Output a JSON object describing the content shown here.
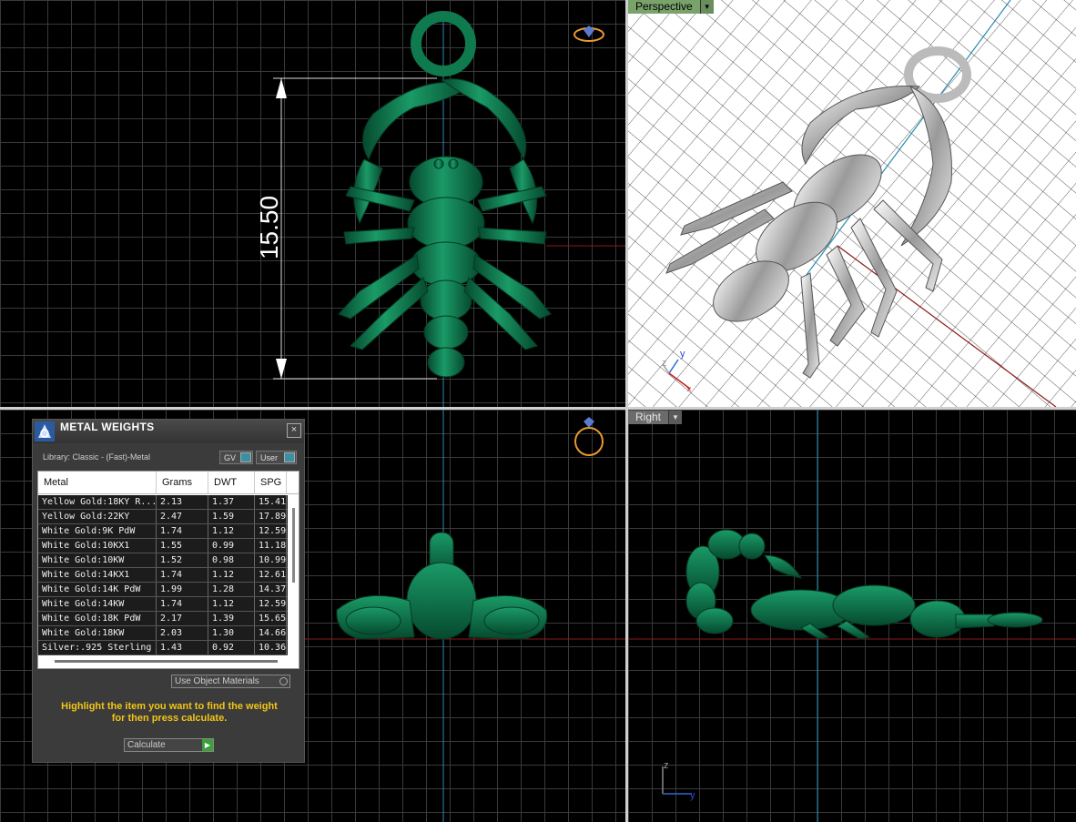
{
  "viewports": {
    "top": {
      "dimension_value": "15.50"
    },
    "perspective": {
      "label": "Perspective",
      "axis_y": "y",
      "axis_z": "z"
    },
    "right": {
      "label": "Right",
      "axis_z": "z",
      "axis_y": "y"
    }
  },
  "metal_weights": {
    "title": "METAL WEIGHTS",
    "close_glyph": "×",
    "library": "Library: Classic - (Fast)-Metal",
    "gv_label": "GV",
    "user_label": "User",
    "columns": [
      "Metal",
      "Grams",
      "DWT",
      "SPG"
    ],
    "rows": [
      [
        "Yellow Gold:18KY R...",
        "2.13",
        "1.37",
        "15.41"
      ],
      [
        "Yellow Gold:22KY",
        "2.47",
        "1.59",
        "17.89"
      ],
      [
        "White Gold:9K PdW",
        "1.74",
        "1.12",
        "12.59"
      ],
      [
        "White Gold:10KX1",
        "1.55",
        "0.99",
        "11.18"
      ],
      [
        "White Gold:10KW",
        "1.52",
        "0.98",
        "10.99"
      ],
      [
        "White Gold:14KX1",
        "1.74",
        "1.12",
        "12.61"
      ],
      [
        "White Gold:14K PdW",
        "1.99",
        "1.28",
        "14.37"
      ],
      [
        "White Gold:14KW",
        "1.74",
        "1.12",
        "12.59"
      ],
      [
        "White Gold:18K PdW",
        "2.17",
        "1.39",
        "15.65"
      ],
      [
        "White Gold:18KW",
        "2.03",
        "1.30",
        "14.66"
      ],
      [
        "Silver:.925 Sterling",
        "1.43",
        "0.92",
        "10.36"
      ]
    ],
    "use_object_materials": "Use Object Materials",
    "hint_line1": "Highlight the item you want to find the weight",
    "hint_line2": "for then press calculate.",
    "calculate": "Calculate"
  },
  "colors": {
    "model": "#0d6b45",
    "grid": "#3a3a3a",
    "hint": "#f2c515",
    "perspective_tab": "#7aa36b"
  },
  "icons": [
    "ring-gem-icon",
    "close-icon",
    "dropdown-arrow-icon",
    "play-arrow-icon",
    "axis-indicator-icon"
  ]
}
